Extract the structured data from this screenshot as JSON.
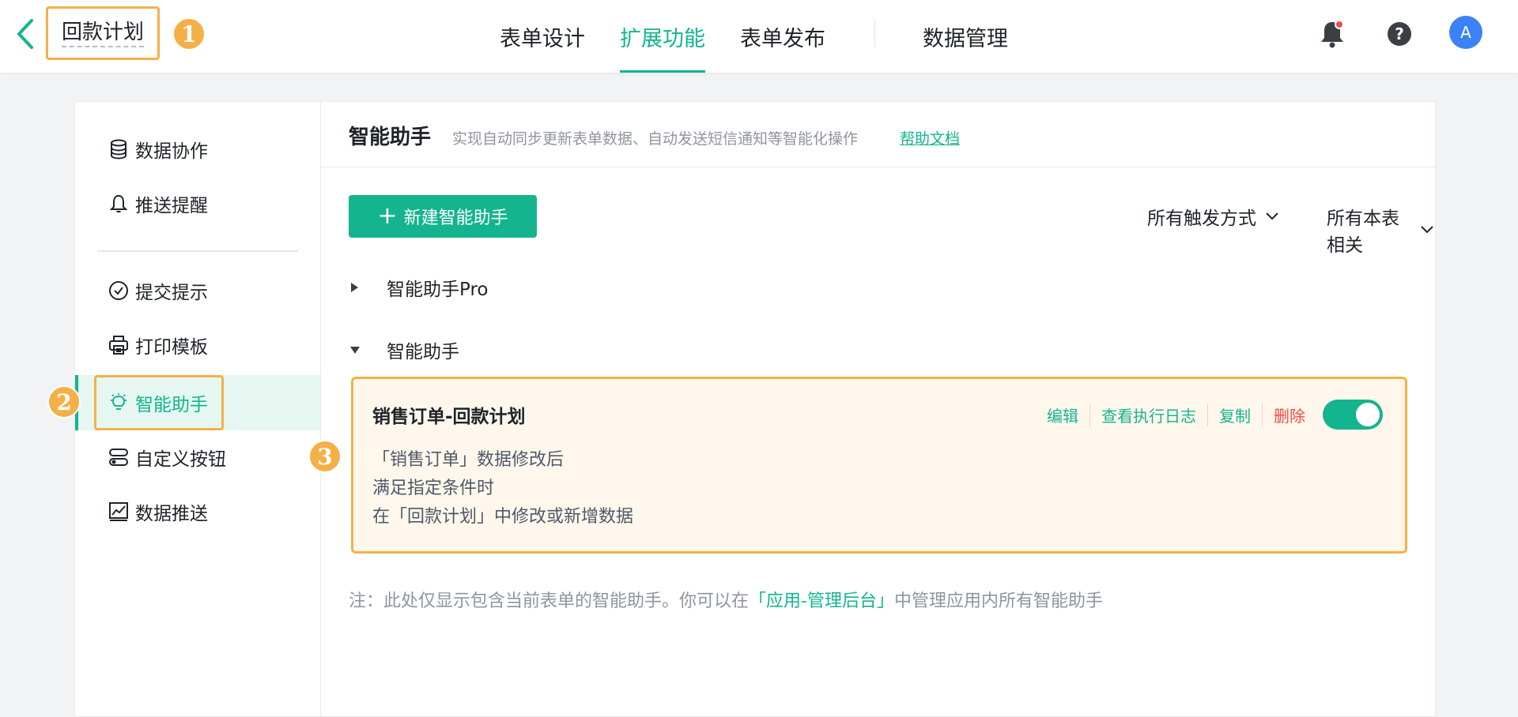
{
  "header": {
    "title": "回款计划",
    "tabs": [
      {
        "label": "表单设计"
      },
      {
        "label": "扩展功能"
      },
      {
        "label": "表单发布"
      },
      {
        "label": "数据管理"
      }
    ],
    "avatar": "A"
  },
  "badges": [
    "1",
    "2",
    "3"
  ],
  "sidebar": {
    "items": [
      {
        "label": "数据协作",
        "icon": "database-icon"
      },
      {
        "label": "推送提醒",
        "icon": "bell-icon"
      },
      {
        "label": "提交提示",
        "icon": "check-circle-icon"
      },
      {
        "label": "打印模板",
        "icon": "printer-icon"
      },
      {
        "label": "智能助手",
        "icon": "bulb-icon"
      },
      {
        "label": "自定义按钮",
        "icon": "custom-button-icon"
      },
      {
        "label": "数据推送",
        "icon": "chart-icon"
      }
    ]
  },
  "content": {
    "title": "智能助手",
    "description": "实现自动同步更新表单数据、自动发送短信通知等智能化操作",
    "help_link": "帮助文档",
    "new_button": "新建智能助手",
    "filters": [
      "所有触发方式",
      "所有本表相关"
    ],
    "groups": [
      "智能助手Pro",
      "智能助手"
    ],
    "card": {
      "title": "销售订单-回款计划",
      "lines": [
        "「销售订单」数据修改后",
        "满足指定条件时",
        "在「回款计划」中修改或新增数据"
      ],
      "actions": [
        "编辑",
        "查看执行日志",
        "复制",
        "删除"
      ],
      "enabled": true
    },
    "note": {
      "prefix": "注：此处仅显示包含当前表单的智能助手。你可以在",
      "link": "「应用-管理后台」",
      "suffix": "中管理应用内所有智能助手"
    }
  },
  "colors": {
    "accent": "#14b48e",
    "highlight": "#f4b047",
    "danger": "#f54a45",
    "avatar": "#3b82f6"
  }
}
